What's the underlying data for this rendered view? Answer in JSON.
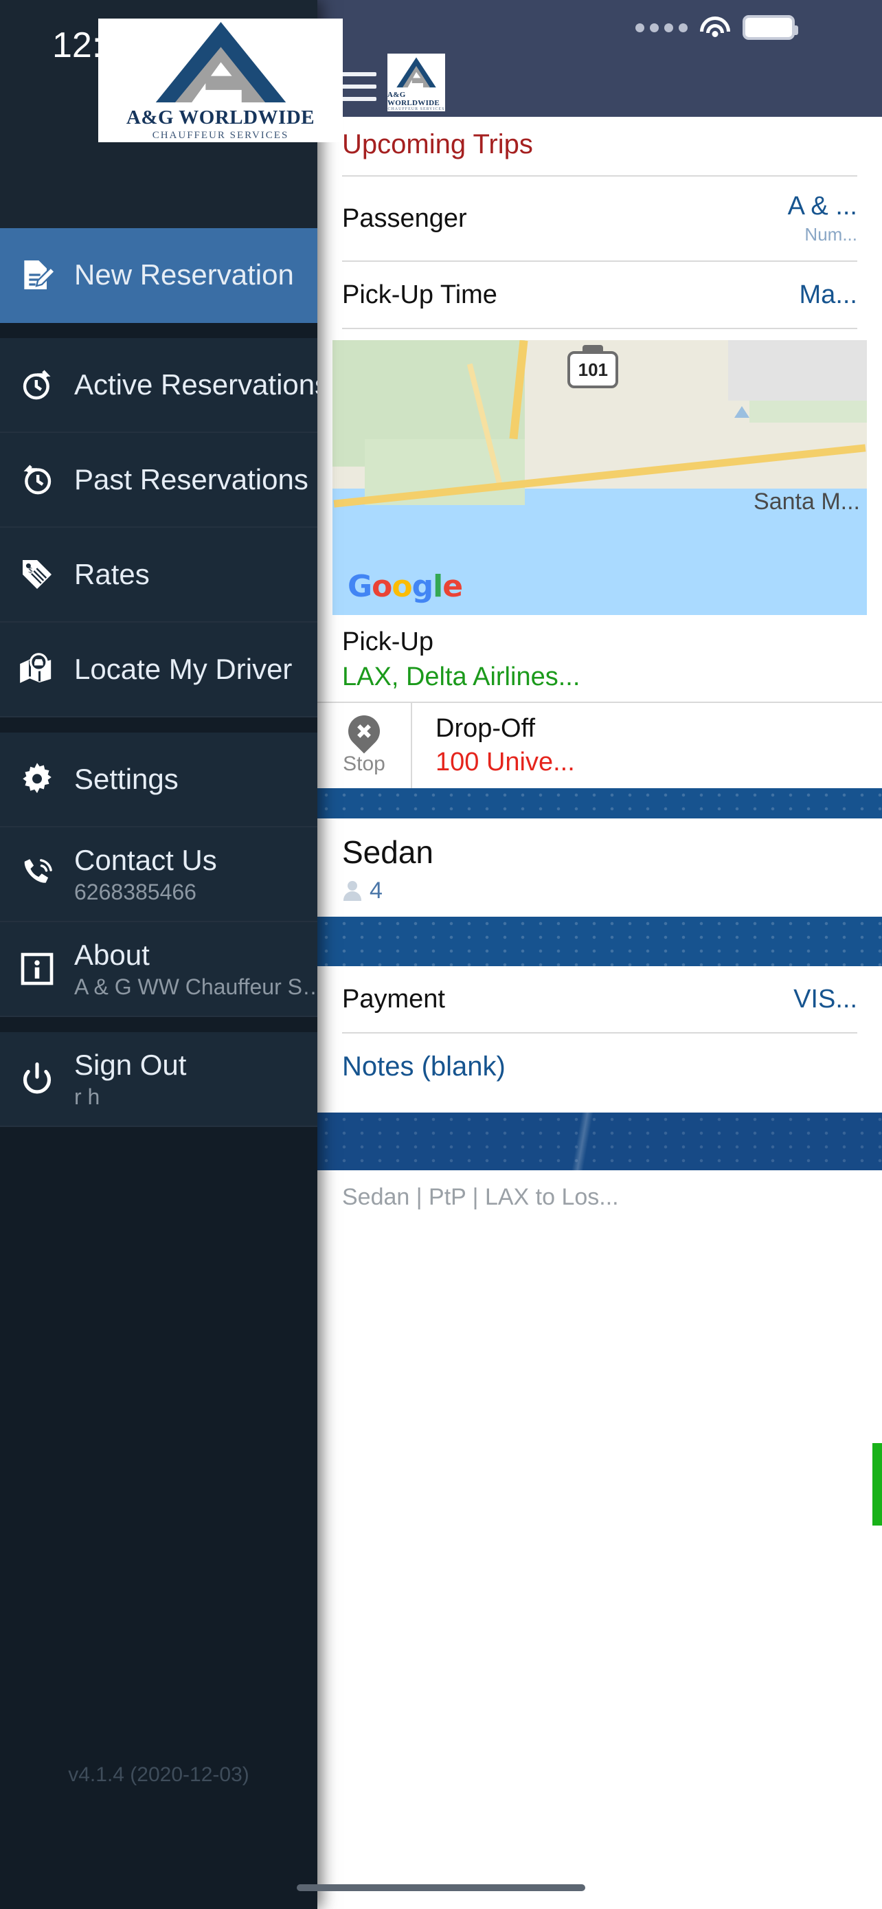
{
  "status_bar": {
    "time": "12:16",
    "wifi_icon": "wifi-icon",
    "battery_icon": "battery-icon",
    "signal_icon": "signal-dots-icon"
  },
  "brand": {
    "name": "A&G WORLDWIDE",
    "tagline": "Chauffeur Services",
    "primary_color": "#1b4a77",
    "secondary_color": "#a0a0a0"
  },
  "drawer": {
    "menu_groups": [
      {
        "items": [
          {
            "label": "New Reservation",
            "icon": "document-edit-icon",
            "active": true,
            "sub": ""
          }
        ]
      },
      {
        "items": [
          {
            "label": "Active Reservations",
            "icon": "clock-forward-icon",
            "active": false,
            "sub": ""
          },
          {
            "label": "Past Reservations",
            "icon": "clock-back-icon",
            "active": false,
            "sub": ""
          },
          {
            "label": "Rates",
            "icon": "price-tag-icon",
            "active": false,
            "sub": ""
          },
          {
            "label": "Locate My Driver",
            "icon": "map-pin-car-icon",
            "active": false,
            "sub": ""
          }
        ]
      },
      {
        "items": [
          {
            "label": "Settings",
            "icon": "gear-icon",
            "active": false,
            "sub": ""
          },
          {
            "label": "Contact Us",
            "icon": "phone-ring-icon",
            "active": false,
            "sub": "6268385466"
          },
          {
            "label": "About",
            "icon": "info-icon",
            "active": false,
            "sub": "A & G WW  Chauffeur Servi..."
          }
        ]
      },
      {
        "items": [
          {
            "label": "Sign Out",
            "icon": "power-icon",
            "active": false,
            "sub": "r h"
          }
        ]
      }
    ],
    "version": "v4.1.4 (2020-12-03)"
  },
  "app": {
    "menu_button": "hamburger-menu-icon",
    "section_title": "Upcoming Trips",
    "rows": [
      {
        "key": "Passenger",
        "value": "A & ...",
        "sub": "Num..."
      },
      {
        "key": "Pick-Up Time",
        "value": "Ma..."
      }
    ],
    "map": {
      "route_shield": "101",
      "city_label": "Santa M...",
      "attribution": "Google"
    },
    "pickup": {
      "label": "Pick-Up",
      "value": "LAX, Delta Airlines..."
    },
    "stop": {
      "label": "Stop",
      "icon": "map-pin-plus-icon"
    },
    "dropoff": {
      "label": "Drop-Off",
      "value": "100 Unive..."
    },
    "vehicle": {
      "name": "Sedan",
      "passenger_count": "4",
      "passenger_icon": "person-icon"
    },
    "payment": {
      "key": "Payment",
      "value": "VIS..."
    },
    "notes": "Notes (blank)",
    "footer_summary": "Sedan | PtP | LAX to Los..."
  }
}
